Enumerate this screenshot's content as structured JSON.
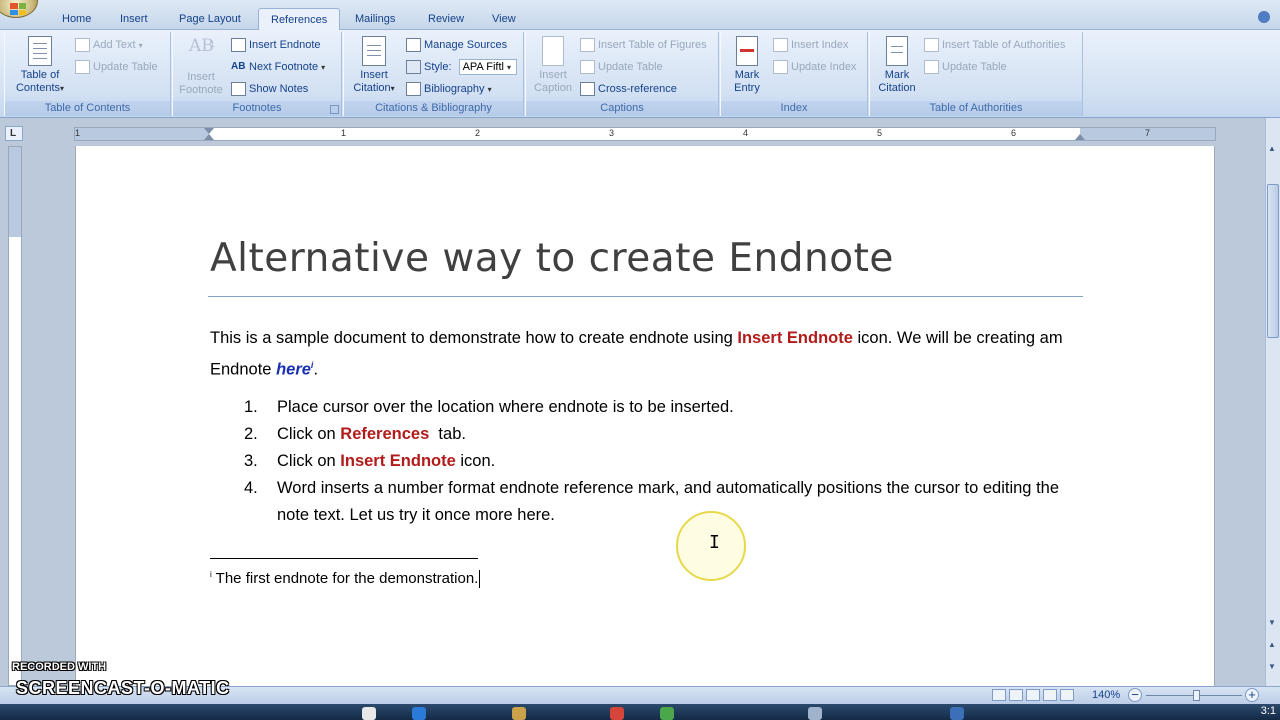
{
  "tabs": [
    "Home",
    "Insert",
    "Page Layout",
    "References",
    "Mailings",
    "Review",
    "View"
  ],
  "active_tab": "References",
  "ribbon": {
    "toc": {
      "big_label": "Table of\nContents",
      "add_text": "Add Text",
      "update_table": "Update Table",
      "group_label": "Table of Contents"
    },
    "footnotes": {
      "insert_footnote": "Insert\nFootnote",
      "insert_endnote": "Insert Endnote",
      "next_footnote": "Next Footnote",
      "show_notes": "Show Notes",
      "group_label": "Footnotes"
    },
    "citations": {
      "insert_citation": "Insert\nCitation",
      "manage_sources": "Manage Sources",
      "style_label": "Style:",
      "style_value": "APA Fiftl",
      "bibliography": "Bibliography",
      "group_label": "Citations & Bibliography"
    },
    "captions": {
      "insert_caption": "Insert\nCaption",
      "insert_table_of_figures": "Insert Table of Figures",
      "update_table": "Update Table",
      "cross_reference": "Cross-reference",
      "group_label": "Captions"
    },
    "index": {
      "mark_entry": "Mark\nEntry",
      "insert_index": "Insert Index",
      "update_index": "Update Index",
      "group_label": "Index"
    },
    "authorities": {
      "mark_citation": "Mark\nCitation",
      "insert_table_of_authorities": "Insert Table of Authorities",
      "update_table": "Update Table",
      "group_label": "Table of Authorities"
    }
  },
  "ruler": {
    "corner_glyph": "L",
    "numbers": [
      "1",
      "1",
      "2",
      "3",
      "4",
      "5",
      "6",
      "7"
    ]
  },
  "document": {
    "title": "Alternative way to create Endnote",
    "para_1": "This is a sample document to demonstrate how to create endnote using ",
    "para_red": "Insert Endnote",
    "para_2": " icon. We will be creating am Endnote ",
    "para_here": "here",
    "para_sup": "i",
    "para_end": ".",
    "steps": [
      {
        "num": "1.",
        "pre": "Place cursor over the location where endnote is to be inserted.",
        "red": "",
        "post": ""
      },
      {
        "num": "2.",
        "pre": "Click on ",
        "red": "References",
        "post": "  tab."
      },
      {
        "num": "3.",
        "pre": "Click on ",
        "red": "Insert Endnote",
        "post": " icon."
      },
      {
        "num": "4.",
        "pre": "Word inserts a number format endnote reference mark, and automatically positions the cursor to editing the note text. Let us try it once more here.",
        "red": "",
        "post": ""
      }
    ],
    "endnote_mark": "i",
    "endnote_text": " The first endnote for the demonstration."
  },
  "status": {
    "zoom": "140%",
    "zoom_minus": "−",
    "zoom_plus": "+"
  },
  "watermark": {
    "top": "RECORDED WITH",
    "main": "SCREENCAST-O-MATIC"
  },
  "clock": "3:1"
}
